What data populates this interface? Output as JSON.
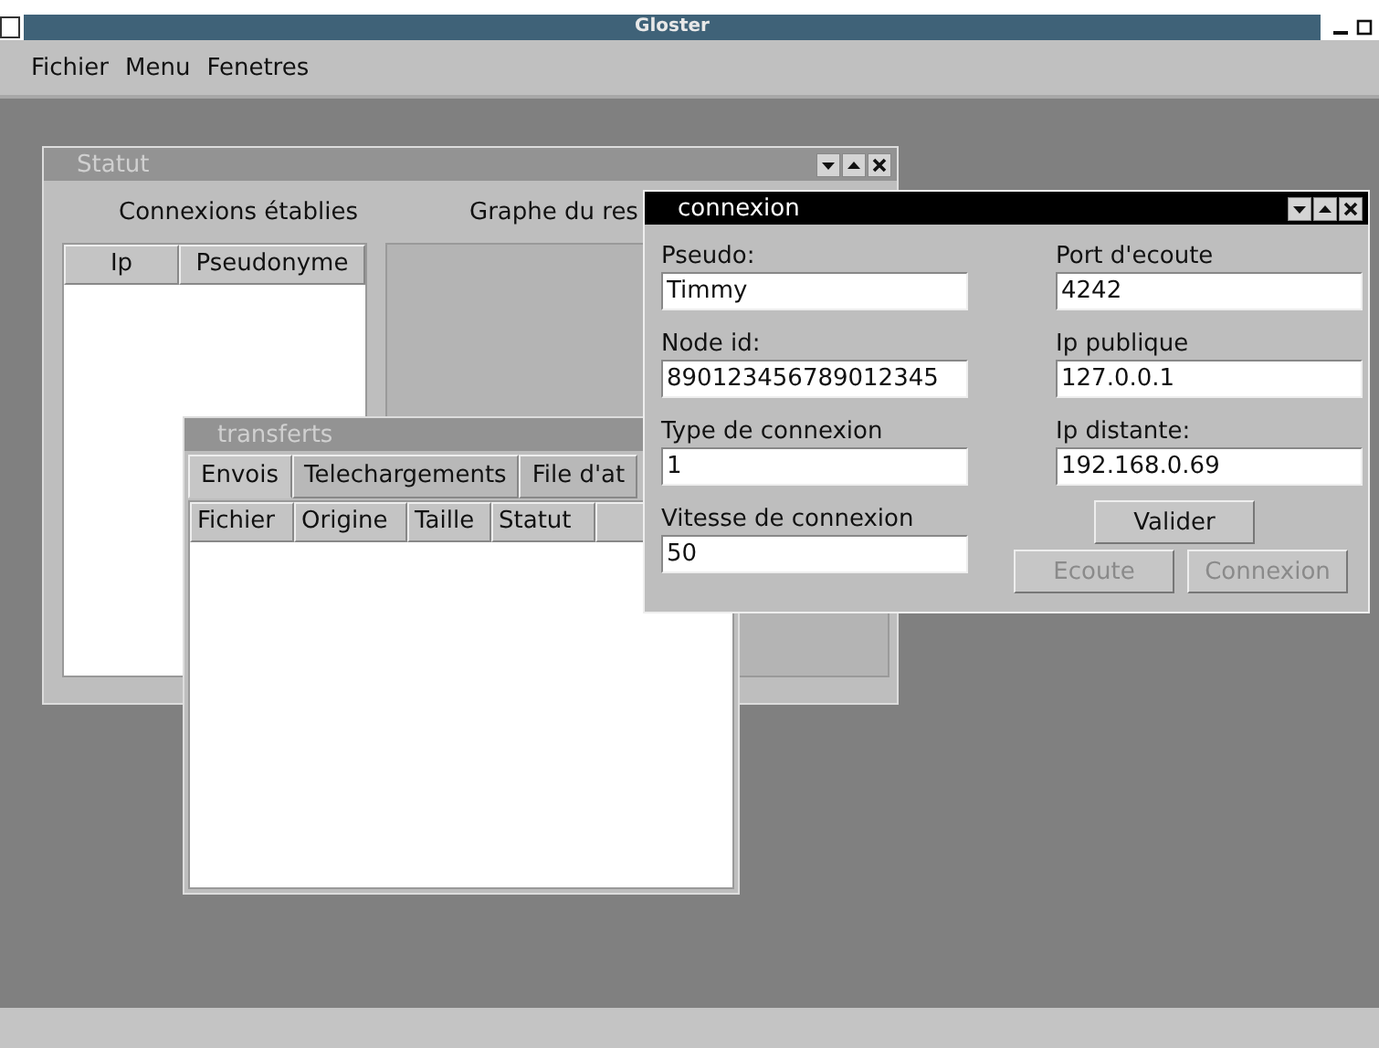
{
  "app": {
    "title": "Gloster"
  },
  "menu": [
    {
      "label": "Fichier"
    },
    {
      "label": "Menu"
    },
    {
      "label": "Fenetres"
    }
  ],
  "statut_window": {
    "title": "Statut",
    "active": false,
    "connections_heading": "Connexions établies",
    "graph_heading": "Graphe du res",
    "table": {
      "columns": [
        "Ip",
        "Pseudonyme"
      ]
    }
  },
  "transferts_window": {
    "title": "transferts",
    "active": false,
    "tabs": [
      {
        "label": "Envois",
        "selected": true
      },
      {
        "label": "Telechargements",
        "selected": false
      },
      {
        "label": "File d'at",
        "selected": false
      }
    ],
    "table": {
      "columns": [
        "Fichier",
        "Origine",
        "Taille",
        "Statut"
      ]
    }
  },
  "connexion_window": {
    "title": "connexion",
    "active": true,
    "left_fields": [
      {
        "label": "Pseudo:",
        "value": "Timmy"
      },
      {
        "label": "Node id:",
        "value": "890123456789012345"
      },
      {
        "label": "Type de connexion",
        "value": "1"
      },
      {
        "label": "Vitesse de connexion",
        "value": "50"
      }
    ],
    "right_fields": [
      {
        "label": "Port d'ecoute",
        "value": "4242"
      },
      {
        "label": "Ip publique",
        "value": "127.0.0.1"
      },
      {
        "label": "Ip distante:",
        "value": "192.168.0.69"
      }
    ],
    "buttons": [
      {
        "label": "Valider",
        "disabled": false
      },
      {
        "label": "Ecoute",
        "disabled": true
      },
      {
        "label": "Connexion",
        "disabled": true
      }
    ]
  }
}
